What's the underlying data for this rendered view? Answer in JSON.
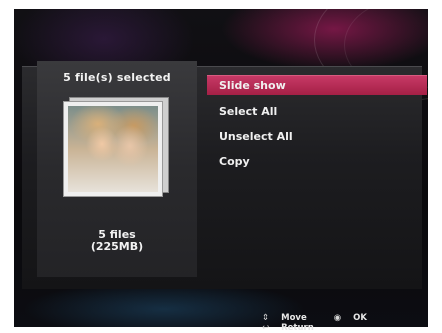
{
  "selection": {
    "title": "5 file(s) selected",
    "files": "5 files",
    "size": "(225MB)"
  },
  "menu": {
    "items": [
      {
        "label": "Slide show",
        "selected": true
      },
      {
        "label": "Select All",
        "selected": false
      },
      {
        "label": "Unselect All",
        "selected": false
      },
      {
        "label": "Copy",
        "selected": false
      }
    ]
  },
  "footer": {
    "move_icon": "up-down-arrow-icon",
    "move_label": "Move",
    "ok_icon": "ok-button-icon",
    "ok_label": "OK",
    "return_icon": "return-arrow-icon",
    "return_label": "Return"
  },
  "colors": {
    "accent": "#c73966",
    "panel": "#2a2a2d",
    "background": "#0b0a0d"
  }
}
